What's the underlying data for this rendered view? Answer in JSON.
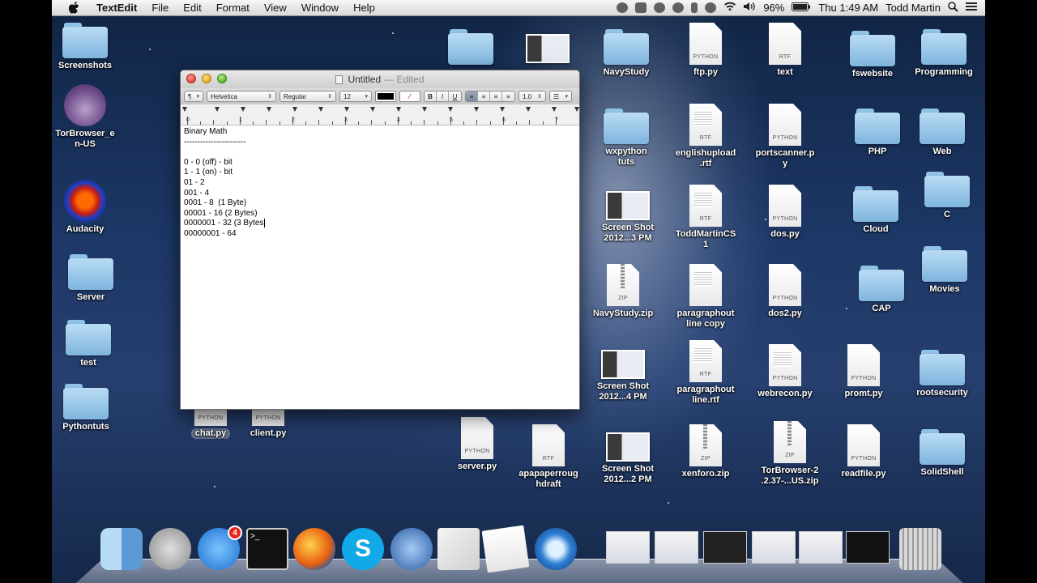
{
  "menubar": {
    "app_name": "TextEdit",
    "menus": [
      "File",
      "Edit",
      "Format",
      "View",
      "Window",
      "Help"
    ],
    "battery": "96%",
    "clock": "Thu 1:49 AM",
    "user": "Todd Martin"
  },
  "window": {
    "title": "Untitled",
    "edited": "— Edited",
    "toolbar": {
      "paragraph_style": "¶",
      "font_family": "Helvetica",
      "font_style": "Regular",
      "font_size": "12",
      "bold": "B",
      "italic": "I",
      "underline": "U",
      "line_spacing": "1.0"
    },
    "ruler_numbers": [
      "0",
      "1",
      "2",
      "3",
      "4",
      "5",
      "6",
      "7"
    ],
    "lines": [
      "Binary Math",
      "-----------------------",
      "",
      "0 - 0 (off) - bit",
      "1 - 1 (on) - bit",
      "01 - 2",
      "001 - 4",
      "0001 - 8  (1 Byte)",
      "00001 - 16 (2 Bytes)",
      "0000001 - 32 (3 Bytes",
      "00000001 - 64"
    ]
  },
  "desktop": {
    "left": [
      {
        "label": "Screenshots",
        "kind": "folder"
      },
      {
        "label": "TorBrowser_e\nn-US",
        "kind": "tor"
      },
      {
        "label": "Audacity",
        "kind": "audacity"
      },
      {
        "label": "Server",
        "kind": "folder"
      },
      {
        "label": "test",
        "kind": "folder"
      },
      {
        "label": "Pythontuts",
        "kind": "folder"
      }
    ],
    "under_window": [
      {
        "label": "chat.py",
        "tag": "PYTHON"
      },
      {
        "label": "client.py",
        "tag": "PYTHON"
      }
    ],
    "grid": [
      {
        "label": "NavyStudy",
        "kind": "folder"
      },
      {
        "label": "ftp.py",
        "kind": "doc",
        "tag": "PYTHON"
      },
      {
        "label": "text",
        "kind": "doc",
        "tag": "RTF"
      },
      {
        "label": "fswebsite",
        "kind": "folder"
      },
      {
        "label": "Programming",
        "kind": "folder"
      },
      {
        "label": "wxpython\ntuts",
        "kind": "folder"
      },
      {
        "label": "englishupload\n.rtf",
        "kind": "doc",
        "tag": "RTF"
      },
      {
        "label": "portscanner.p\ny",
        "kind": "doc",
        "tag": "PYTHON"
      },
      {
        "label": "PHP",
        "kind": "folder"
      },
      {
        "label": "Web",
        "kind": "folder"
      },
      {
        "label": "C",
        "kind": "folder"
      },
      {
        "label": "Screen Shot\n2012...3 PM",
        "kind": "shot"
      },
      {
        "label": "ToddMartinCS\n1",
        "kind": "doc",
        "tag": "RTF"
      },
      {
        "label": "dos.py",
        "kind": "doc",
        "tag": "PYTHON"
      },
      {
        "label": "Cloud",
        "kind": "folder"
      },
      {
        "label": "Movies",
        "kind": "folder"
      },
      {
        "label": "NavyStudy.zip",
        "kind": "zip",
        "tag": "ZIP"
      },
      {
        "label": "paragraphout\nline copy",
        "kind": "doc",
        "tag": ""
      },
      {
        "label": "dos2.py",
        "kind": "doc",
        "tag": "PYTHON"
      },
      {
        "label": "CAP",
        "kind": "folder"
      },
      {
        "label": "Screen Shot\n2012...4 PM",
        "kind": "shot"
      },
      {
        "label": "paragraphout\nline.rtf",
        "kind": "doc",
        "tag": "RTF"
      },
      {
        "label": "webrecon.py",
        "kind": "doc",
        "tag": "PYTHON"
      },
      {
        "label": "promt.py",
        "kind": "doc",
        "tag": "PYTHON"
      },
      {
        "label": "rootsecurity",
        "kind": "folder"
      },
      {
        "label": "server.py",
        "kind": "doc",
        "tag": "PYTHON"
      },
      {
        "label": "apapaperroug\nhdraft",
        "kind": "doc",
        "tag": "RTF"
      },
      {
        "label": "Screen Shot\n2012...2 PM",
        "kind": "shot"
      },
      {
        "label": "xenforo.zip",
        "kind": "zip",
        "tag": "ZIP"
      },
      {
        "label": "TorBrowser-2\n.2.37-...US.zip",
        "kind": "zip",
        "tag": "ZIP"
      },
      {
        "label": "readfile.py",
        "kind": "doc",
        "tag": "PYTHON"
      },
      {
        "label": "SolidShell",
        "kind": "folder"
      },
      {
        "label": "",
        "kind": "folder"
      },
      {
        "label": "",
        "kind": "shot"
      }
    ]
  },
  "dock": {
    "app_store_badge": "4",
    "apps": [
      "finder-icon",
      "launchpad-icon",
      "app-store-icon",
      "terminal-icon",
      "firefox-icon",
      "skype-icon",
      "thunderbird-icon",
      "python-launcher-icon",
      "textedit-icon",
      "quicktime-icon"
    ]
  },
  "colors": {
    "menubar": "#e9e9e9",
    "folder": "#9ccbee",
    "badge": "#e5261f"
  }
}
